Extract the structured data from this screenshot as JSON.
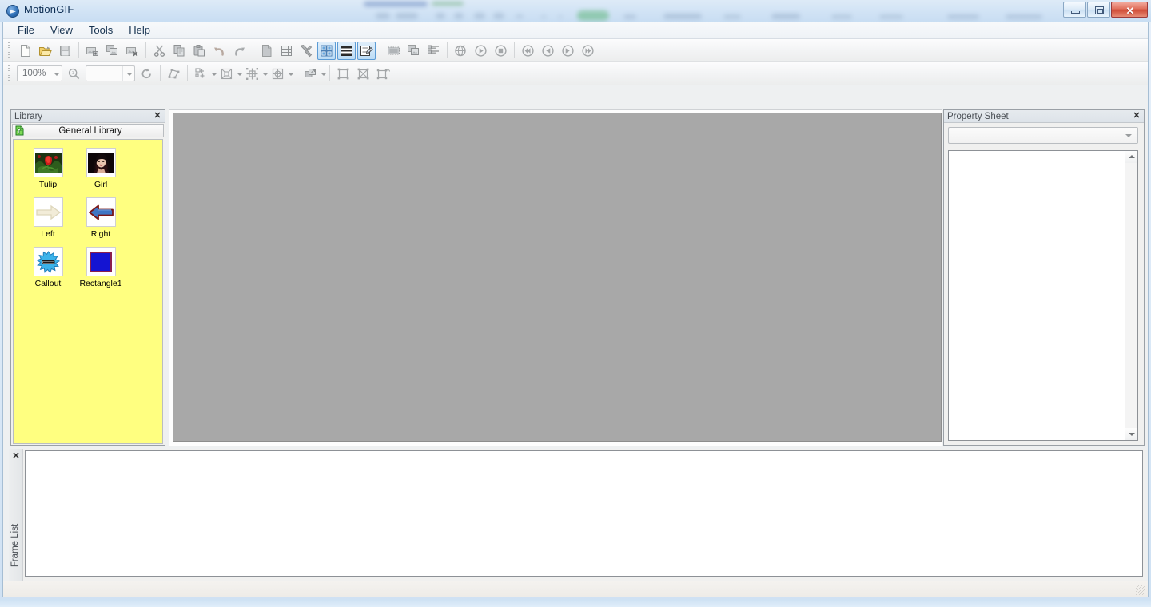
{
  "window": {
    "title": "MotionGIF",
    "icon": "motiongif-app-icon",
    "buttons": {
      "minimize": "–",
      "maximize": "□",
      "close": "✕"
    }
  },
  "menu": {
    "items": [
      {
        "label": "File"
      },
      {
        "label": "View"
      },
      {
        "label": "Tools"
      },
      {
        "label": "Help"
      }
    ]
  },
  "toolbar_main": {
    "groups": [
      {
        "buttons": [
          {
            "name": "new-file-icon",
            "title": "New"
          },
          {
            "name": "open-folder-icon",
            "title": "Open"
          },
          {
            "name": "save-icon",
            "title": "Save"
          }
        ]
      },
      {
        "buttons": [
          {
            "name": "insert-image-icon",
            "title": "Insert Image"
          },
          {
            "name": "duplicate-image-icon",
            "title": "Duplicate Image"
          },
          {
            "name": "delete-image-icon",
            "title": "Delete Image"
          }
        ]
      },
      {
        "buttons": [
          {
            "name": "cut-icon",
            "title": "Cut"
          },
          {
            "name": "copy-icon",
            "title": "Copy"
          },
          {
            "name": "paste-icon",
            "title": "Paste"
          },
          {
            "name": "undo-icon",
            "title": "Undo"
          },
          {
            "name": "redo-icon",
            "title": "Redo"
          }
        ]
      },
      {
        "buttons": [
          {
            "name": "page-icon",
            "title": "Page"
          },
          {
            "name": "grid-icon",
            "title": "Grid"
          },
          {
            "name": "tools-icon",
            "title": "Tools"
          },
          {
            "name": "library-view-icon",
            "title": "Library",
            "active": true
          },
          {
            "name": "frame-list-view-icon",
            "title": "Frame List",
            "active": true
          },
          {
            "name": "property-sheet-icon",
            "title": "Property Sheet",
            "active": true
          }
        ]
      },
      {
        "buttons": [
          {
            "name": "filmstrip-icon",
            "title": "Filmstrip"
          },
          {
            "name": "layers-icon",
            "title": "Layers"
          },
          {
            "name": "list-properties-icon",
            "title": "List Properties"
          }
        ]
      },
      {
        "buttons": [
          {
            "name": "preview-globe-icon",
            "title": "Preview"
          },
          {
            "name": "play-icon",
            "title": "Play"
          },
          {
            "name": "stop-icon",
            "title": "Stop"
          }
        ]
      },
      {
        "buttons": [
          {
            "name": "skip-first-icon",
            "title": "First Frame"
          },
          {
            "name": "step-back-icon",
            "title": "Previous Frame"
          },
          {
            "name": "step-forward-icon",
            "title": "Next Frame"
          },
          {
            "name": "skip-last-icon",
            "title": "Last Frame"
          }
        ]
      }
    ]
  },
  "toolbar_edit": {
    "zoom": {
      "value": "100%",
      "placeholder": "100%"
    },
    "zoom_tool": {
      "name": "zoom-tool-icon",
      "title": "Zoom"
    },
    "color": {
      "value": "",
      "placeholder": ""
    },
    "rotate": {
      "name": "rotate-icon",
      "title": "Rotate"
    },
    "transform": {
      "name": "transform-shape-icon",
      "title": "Transform"
    },
    "groups": [
      {
        "name": "align-objects-icon",
        "title": "Align"
      },
      {
        "name": "distribute-objects-icon",
        "title": "Distribute"
      },
      {
        "name": "resize-objects-icon",
        "title": "Resize"
      },
      {
        "name": "center-objects-icon",
        "title": "Center"
      },
      {
        "name": "order-objects-icon",
        "title": "Order"
      },
      {
        "name": "group-objects-icon",
        "title": "Group"
      },
      {
        "name": "ungroup-objects-icon",
        "title": "Ungroup"
      },
      {
        "name": "lock-objects-icon",
        "title": "Lock"
      }
    ]
  },
  "library": {
    "caption": "Library",
    "close_label": "✕",
    "header_title": "General Library",
    "header_icon": "green-up-arrow-page-icon",
    "background_color": "#ffff80",
    "items": [
      {
        "label": "Tulip",
        "icon": "tulip-thumbnail"
      },
      {
        "label": "Girl",
        "icon": "girl-thumbnail"
      },
      {
        "label": "Left",
        "icon": "left-arrow-outline-thumbnail"
      },
      {
        "label": "Right",
        "icon": "right-arrow-blue-thumbnail"
      },
      {
        "label": "Callout",
        "icon": "callout-starburst-thumbnail"
      },
      {
        "label": "Rectangle1",
        "icon": "blue-rectangle-thumbnail"
      }
    ]
  },
  "canvas": {
    "name": "document-canvas",
    "background_color": "#a8a8a8"
  },
  "property_sheet": {
    "caption": "Property Sheet",
    "close_label": "✕",
    "selector_value": "",
    "selector_placeholder": "",
    "list_items": []
  },
  "frame_list": {
    "caption": "Frame List",
    "close_label": "✕",
    "frames": []
  },
  "status_bar": {
    "text": ""
  }
}
